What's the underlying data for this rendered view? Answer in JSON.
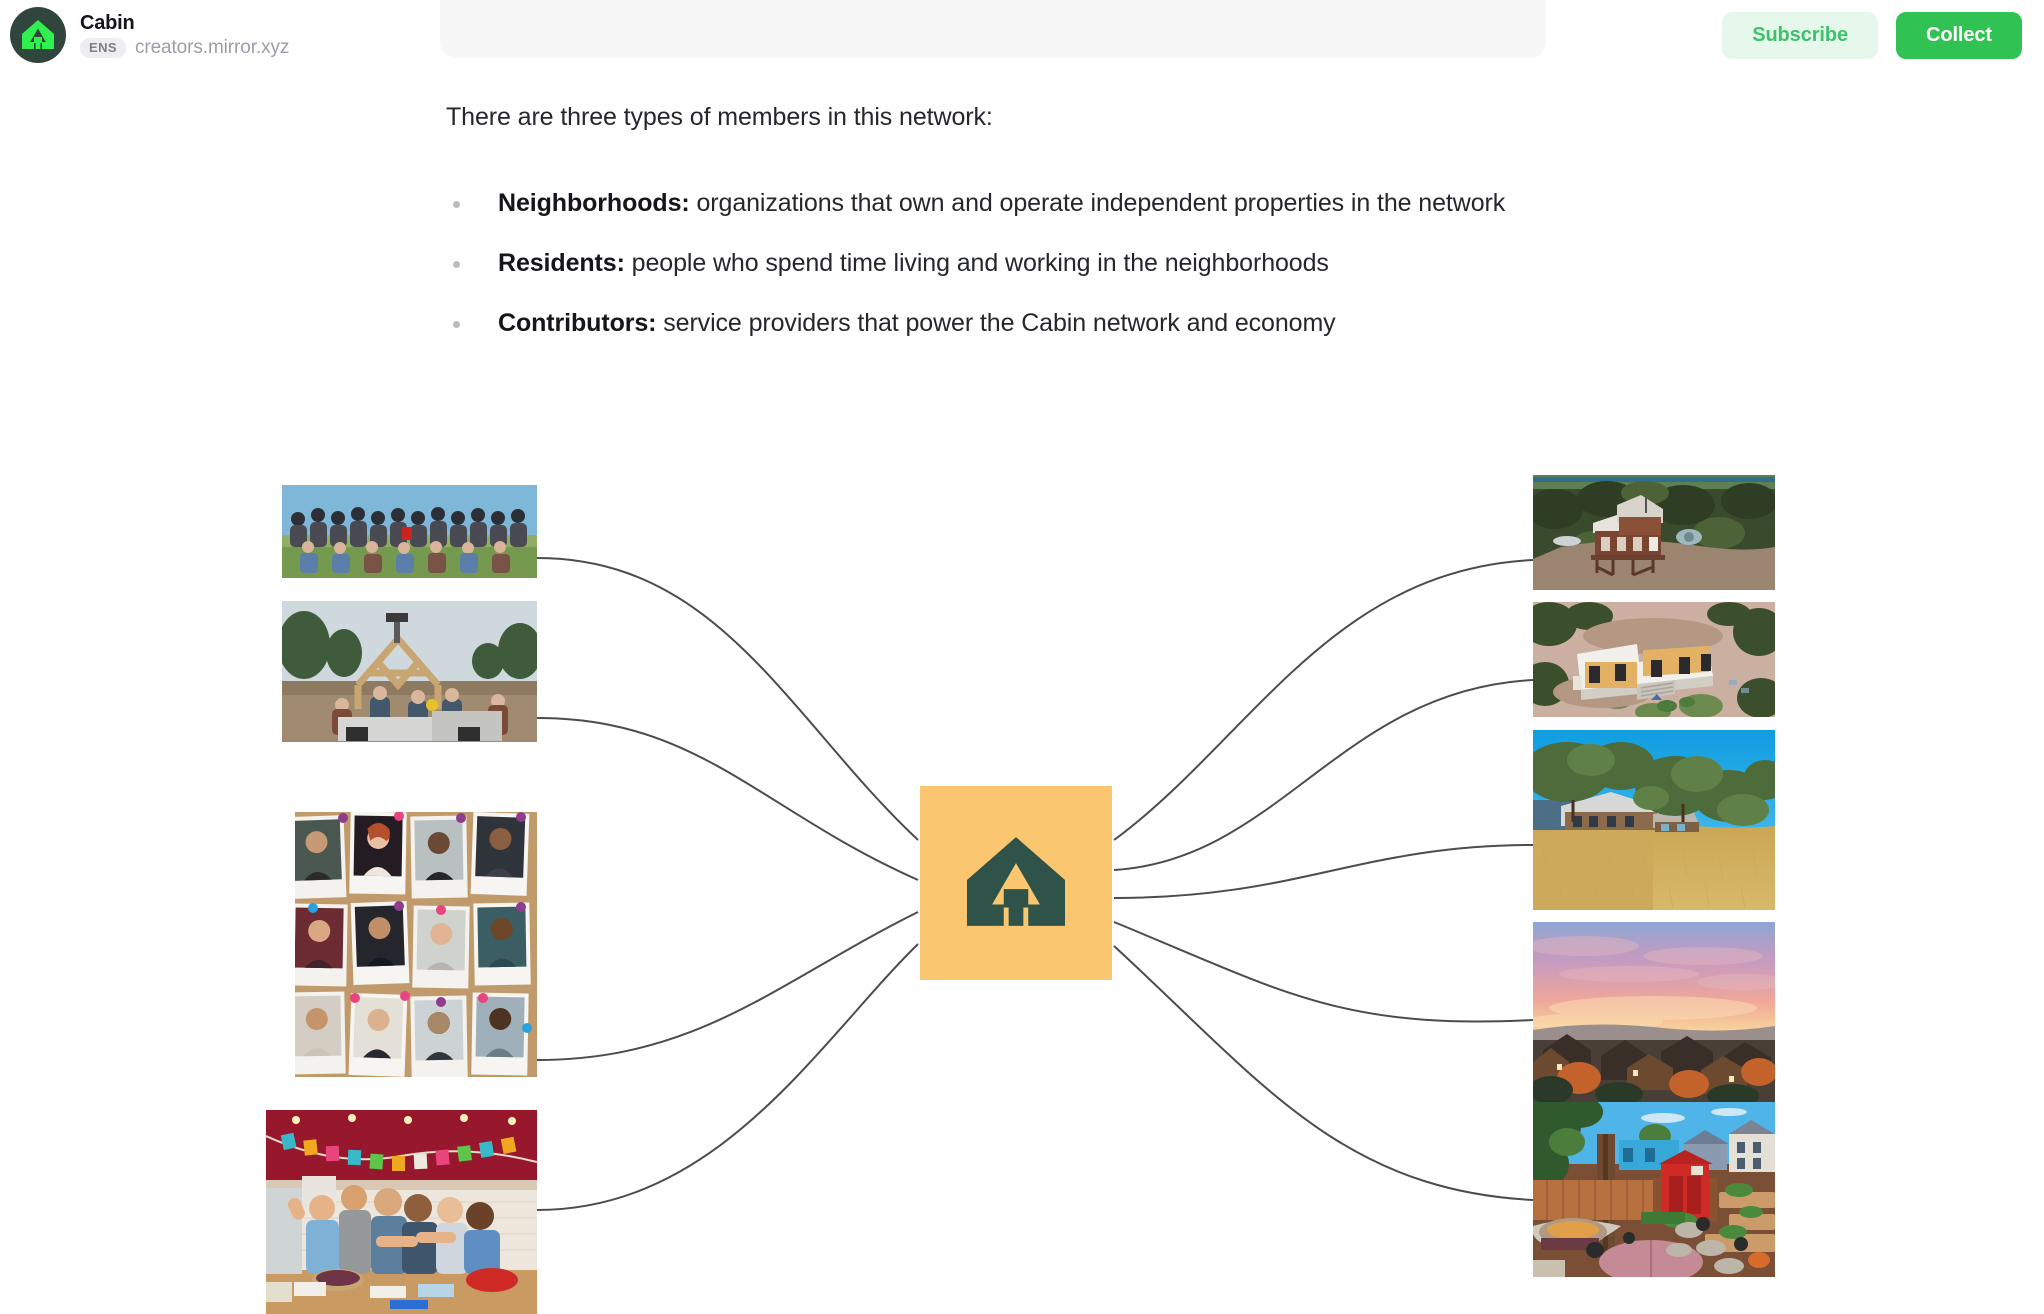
{
  "header": {
    "brand_name": "Cabin",
    "ens_badge": "ENS",
    "ens_domain": "creators.mirror.xyz",
    "subscribe_label": "Subscribe",
    "collect_label": "Collect",
    "avatar_icon": "cabin-tent-logo-icon",
    "colors": {
      "avatar_bg": "#30463c",
      "avatar_glyph": "#2ff04f",
      "subscribe_bg": "#e6f8ec",
      "subscribe_text": "#3ec16a",
      "collect_bg": "#31c254",
      "collect_text": "#ffffff"
    }
  },
  "article": {
    "intro": "There are three types of members in this network:",
    "bullets": [
      {
        "term": "Neighborhoods:",
        "description": " organizations that own and operate independent properties in the network"
      },
      {
        "term": "Residents:",
        "description": " people who spend time living and working in the neighborhoods"
      },
      {
        "term": "Contributors:",
        "description": " service providers that power the Cabin network and economy"
      }
    ]
  },
  "diagram": {
    "center_icon": "cabin-tent-logo-icon",
    "center_bg": "#fbc670",
    "center_glyph": "#2f5349",
    "link_color": "#4c4c4c",
    "left_thumbnails": [
      {
        "name": "group-photo-outdoors",
        "alt": "Large group of people posing outdoors on grass"
      },
      {
        "name": "barn-raising-construction",
        "alt": "People building a timber frame structure with a skid loader"
      },
      {
        "name": "polaroid-member-wall",
        "alt": "Cork board covered in polaroid portraits of members"
      },
      {
        "name": "kitchen-gathering",
        "alt": "Group of people cooking together in a kitchen with colorful bunting"
      }
    ],
    "right_thumbnails": [
      {
        "name": "aerial-cabin-on-stilts",
        "alt": "Aerial view of a wooden cabin on stilts in a forest"
      },
      {
        "name": "aerial-modern-cabin",
        "alt": "Aerial view of a modern flat-roof cabin on pale ground"
      },
      {
        "name": "ranch-house-on-hill",
        "alt": "Ranch house on a golden grass hill under blue sky with oak trees"
      },
      {
        "name": "sunset-over-rooftops",
        "alt": "Pink and orange sunset sky over neighborhood rooftops"
      },
      {
        "name": "backyard-garden-shed",
        "alt": "Backyard with raised garden beds, fire pit and a red shed"
      }
    ]
  }
}
